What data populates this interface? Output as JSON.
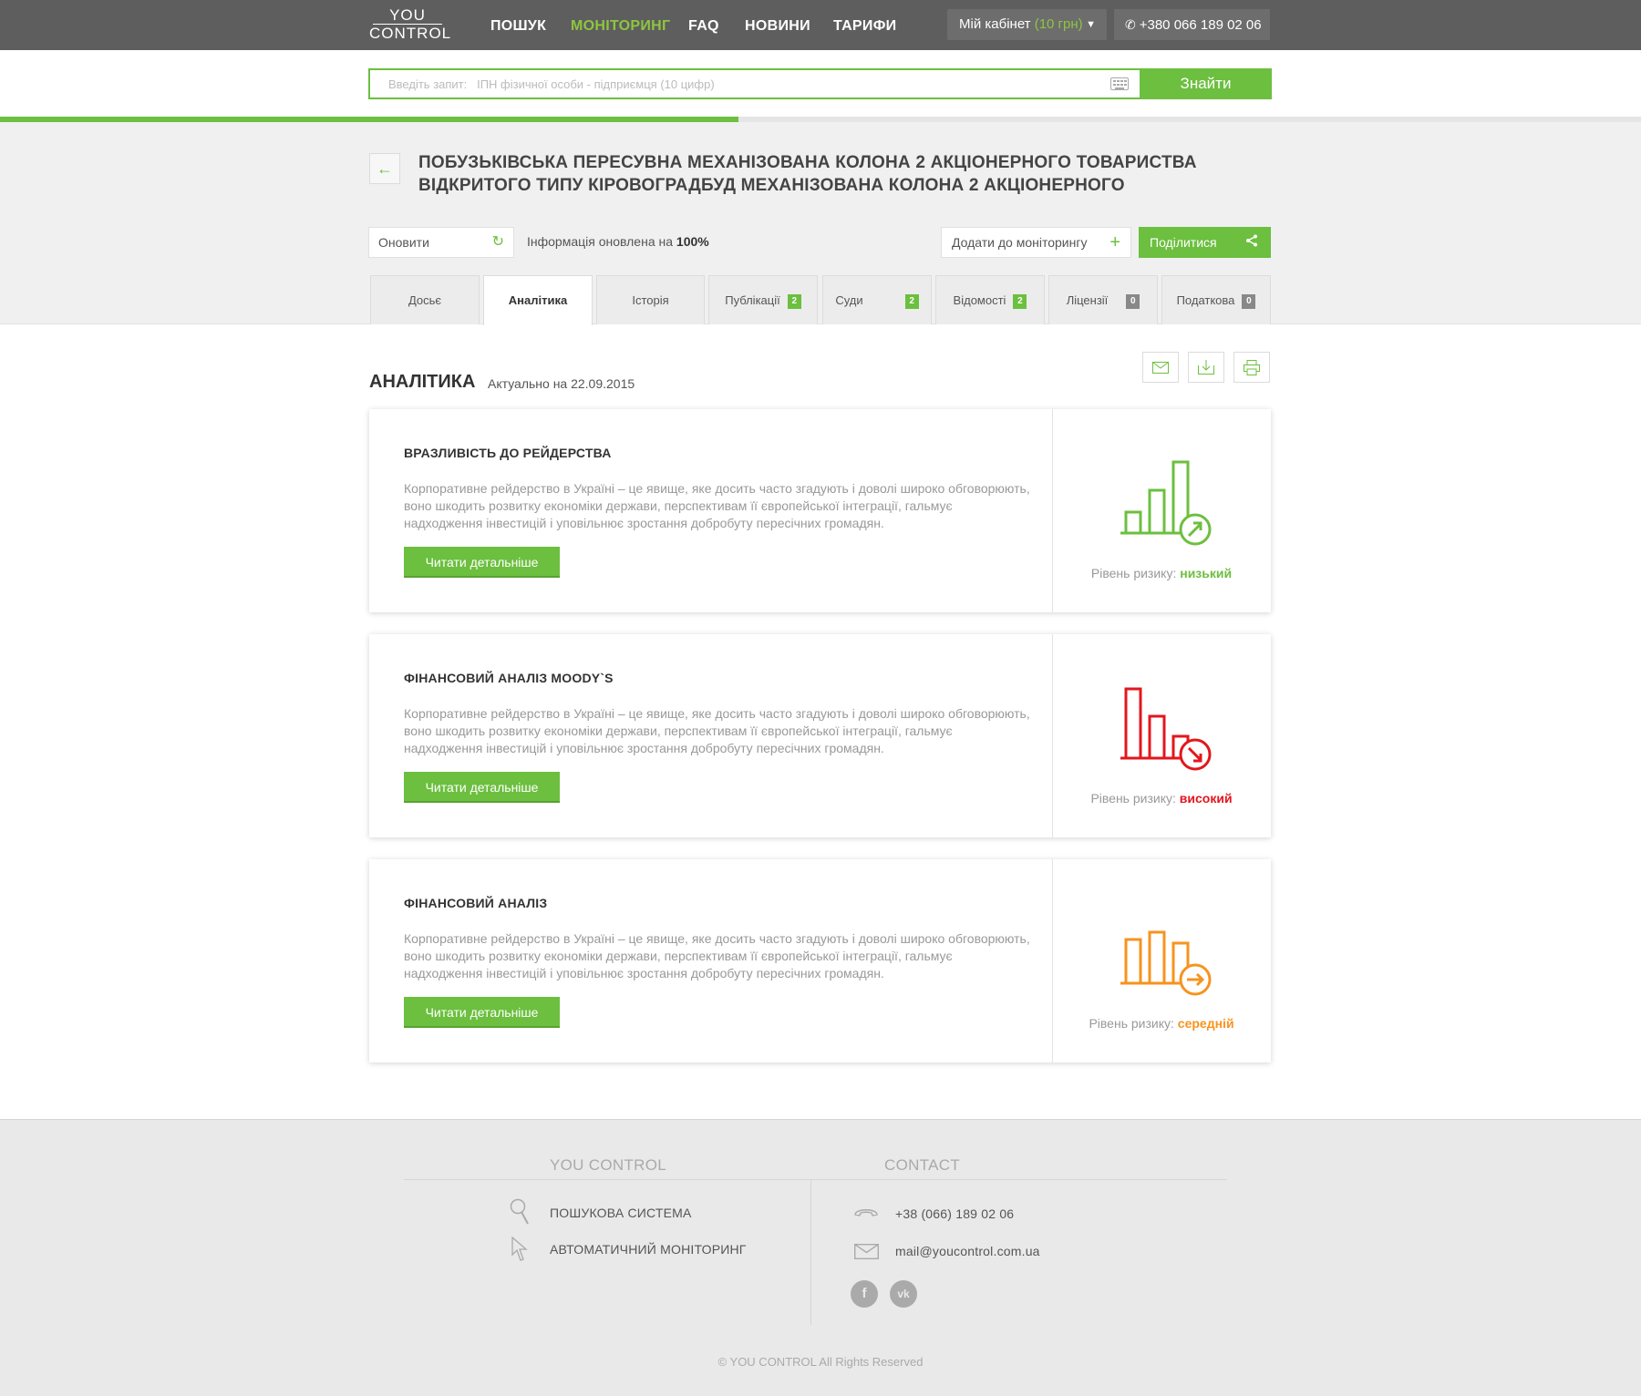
{
  "header": {
    "logo_top": "YOU",
    "logo_bottom": "CONTROL",
    "nav": [
      "ПОШУК",
      "МОНІТОРИНГ",
      "FAQ",
      "НОВИНИ",
      "ТАРИФИ"
    ],
    "active_nav": "МОНІТОРИНГ",
    "cabinet_label": "Мій кабінет",
    "cabinet_balance": "(10 грн)",
    "phone": "+380 066 189 02 06"
  },
  "search": {
    "placeholder": "Введіть запит:   ІПН фізичної особи - підприємця (10 цифр)",
    "button": "Знайти"
  },
  "progress": {
    "value_percent": 45
  },
  "company": {
    "title_line1": "ПОБУЗЬКІВСЬКА ПЕРЕСУВНА МЕХАНІЗОВАНА КОЛОНА 2 АКЦІОНЕРНОГО ТОВАРИСТВА",
    "title_line2": "ВІДКРИТОГО ТИПУ КІРОВОГРАДБУД МЕХАНІЗОВАНА КОЛОНА 2 АКЦІОНЕРНОГО"
  },
  "actions": {
    "refresh": "Оновити",
    "info_prefix": "Інформація оновлена на",
    "info_value": "100%",
    "add_monitoring": "Додати до моніторингу",
    "share": "Поділитися"
  },
  "tabs": [
    {
      "label": "Досьє",
      "badge": ""
    },
    {
      "label": "Аналітика",
      "badge": ""
    },
    {
      "label": "Історія",
      "badge": ""
    },
    {
      "label": "Публікації",
      "badge": "2"
    },
    {
      "label": "Суди",
      "badge": "2"
    },
    {
      "label": "Відомості",
      "badge": "2"
    },
    {
      "label": "Ліцензії",
      "badge": "0"
    },
    {
      "label": "Податкова",
      "badge": "0"
    }
  ],
  "section": {
    "title": "АНАЛІТИКА",
    "date": "Актуально на 22.09.2015"
  },
  "cards": [
    {
      "title": "ВРАЗЛИВІСТЬ ДО РЕЙДЕРСТВА",
      "desc": "Корпоративне рейдерство в Україні – це явище, яке досить часто згадують і доволі широко обговорюють, воно шкодить розвитку економіки держави, перспективам її європейської інтеграції, гальмує надходження інвестицій і уповільнює зростання добробуту пересічних громадян.",
      "button": "Читати детальніше",
      "risk_label": "Рівень ризику:",
      "risk_value": "низький",
      "color": "#6cbf3f"
    },
    {
      "title": "ФІНАНСОВИЙ АНАЛІЗ MOODY`S",
      "desc": "Корпоративне рейдерство в Україні – це явище, яке досить часто згадують і доволі широко обговорюють, воно шкодить розвитку економіки держави, перспективам її європейської інтеграції, гальмує надходження інвестицій і уповільнює зростання добробуту пересічних громадян.",
      "button": "Читати детальніше",
      "risk_label": "Рівень ризику:",
      "risk_value": "високий",
      "color": "#e3161d"
    },
    {
      "title": "ФІНАНСОВИЙ АНАЛІЗ",
      "desc": "Корпоративне рейдерство в Україні – це явище, яке досить часто згадують і доволі широко обговорюють, воно шкодить розвитку економіки держави, перспективам її європейської інтеграції, гальмує надходження інвестицій і уповільнює зростання добробуту пересічних громадян.",
      "button": "Читати детальніше",
      "risk_label": "Рівень ризику:",
      "risk_value": "середній",
      "color": "#f7931e"
    }
  ],
  "footer": {
    "col1_title": "YOU CONTROL",
    "col1_items": [
      "ПОШУКОВА СИСТЕМА",
      "АВТОМАТИЧНИЙ МОНІТОРИНГ"
    ],
    "col2_title": "CONTACT",
    "phone": "+38 (066) 189 02 06",
    "email": "mail@youcontrol.com.ua",
    "copyright": "© YOU CONTROL All Rights Reserved"
  }
}
